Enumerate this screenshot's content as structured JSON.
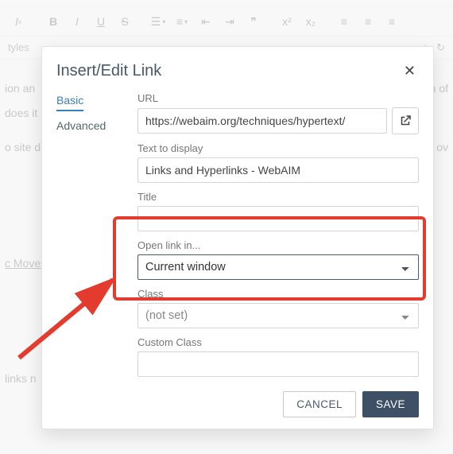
{
  "bg": {
    "styles_label": "tyles",
    "line1_a": "ion an",
    "line1_b": "vision of",
    "line2": "does it",
    "line3_a": "o site d",
    "line3_b": "ilture ov",
    "link": "c Moves",
    "line4": "links n",
    "extras_icon1": "+",
    "extras_icon2": "↻"
  },
  "dialog": {
    "title": "Insert/Edit Link",
    "tabs": {
      "basic": "Basic",
      "advanced": "Advanced"
    },
    "url_label": "URL",
    "url_value": "https://webaim.org/techniques/hypertext/",
    "text_label": "Text to display",
    "text_value": "Links and Hyperlinks - WebAIM",
    "title_label": "Title",
    "title_value": "",
    "open_label": "Open link in...",
    "open_value": "Current window",
    "class_label": "Class",
    "class_value": "(not set)",
    "custom_label": "Custom Class",
    "custom_value": "",
    "cancel": "CANCEL",
    "save": "SAVE"
  }
}
